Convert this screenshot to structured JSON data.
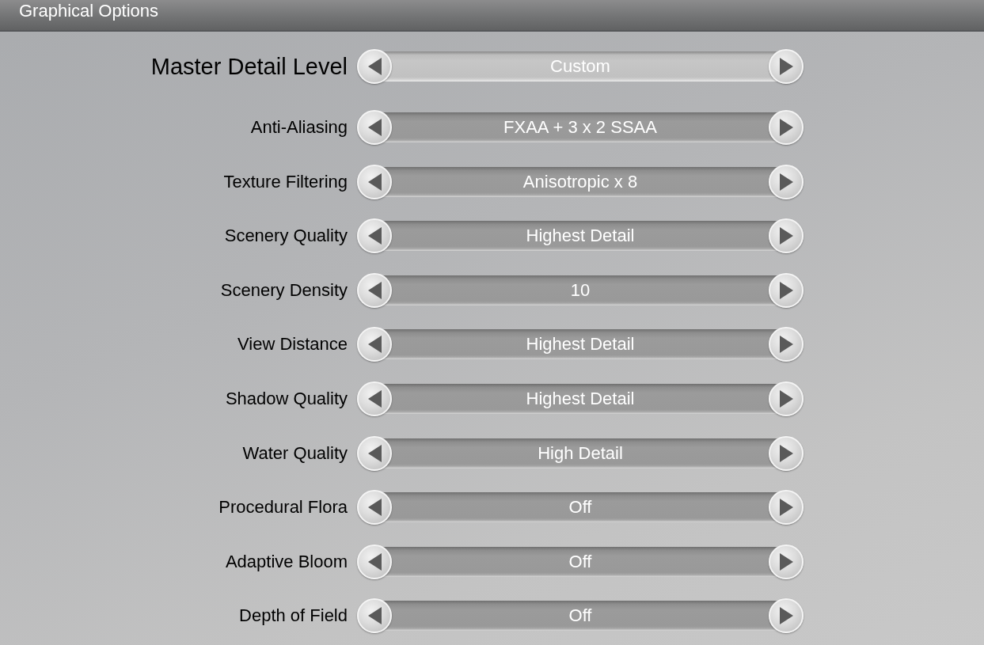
{
  "window": {
    "title": "Graphical Options"
  },
  "settings": [
    {
      "kind": "master",
      "label": "Master Detail Level",
      "value": "Custom"
    },
    {
      "kind": "setting",
      "label": "Anti-Aliasing",
      "value": "FXAA + 3 x 2 SSAA"
    },
    {
      "kind": "setting",
      "label": "Texture Filtering",
      "value": "Anisotropic x 8"
    },
    {
      "kind": "setting",
      "label": "Scenery Quality",
      "value": "Highest Detail"
    },
    {
      "kind": "setting",
      "label": "Scenery Density",
      "value": "10"
    },
    {
      "kind": "setting",
      "label": "View Distance",
      "value": "Highest Detail"
    },
    {
      "kind": "setting",
      "label": "Shadow Quality",
      "value": "Highest Detail"
    },
    {
      "kind": "setting",
      "label": "Water Quality",
      "value": "High Detail"
    },
    {
      "kind": "setting",
      "label": "Procedural Flora",
      "value": "Off"
    },
    {
      "kind": "setting",
      "label": "Adaptive Bloom",
      "value": "Off"
    },
    {
      "kind": "setting",
      "label": "Depth of Field",
      "value": "Off"
    }
  ]
}
